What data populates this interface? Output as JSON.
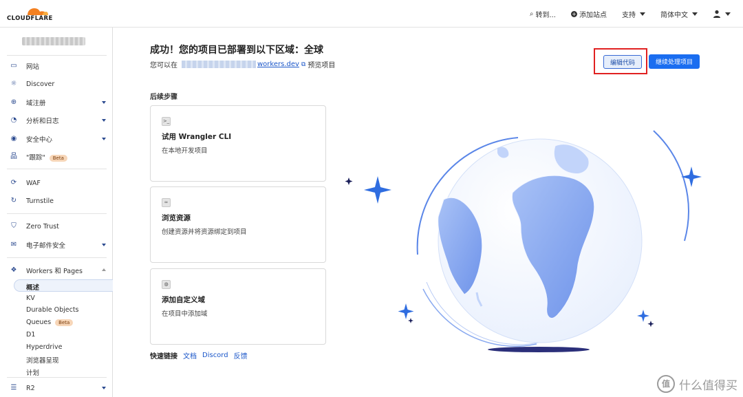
{
  "brand": {
    "name": "CLOUDFLARE",
    "accent": "#f38020"
  },
  "topnav": {
    "goto": "转到...",
    "add_site": "添加站点",
    "support": "支持",
    "language": "简体中文"
  },
  "sidebar": {
    "items": [
      {
        "label": "网站",
        "icon": "browser-icon"
      },
      {
        "label": "Discover",
        "icon": "lightbulb-icon"
      },
      {
        "label": "域注册",
        "icon": "globe-icon"
      },
      {
        "label": "分析和日志",
        "icon": "clock-chart-icon"
      },
      {
        "label": "安全中心",
        "icon": "target-icon"
      },
      {
        "label": "\"跟踪\"",
        "icon": "network-icon",
        "badge": "Beta"
      },
      {
        "label": "WAF",
        "icon": "waf-icon"
      },
      {
        "label": "Turnstile",
        "icon": "turnstile-icon"
      },
      {
        "label": "Zero Trust",
        "icon": "shield-icon"
      },
      {
        "label": "电子邮件安全",
        "icon": "mail-icon"
      },
      {
        "label": "Workers 和 Pages",
        "icon": "workers-icon"
      }
    ],
    "subitems": [
      {
        "label": "概述"
      },
      {
        "label": "KV"
      },
      {
        "label": "Durable Objects"
      },
      {
        "label": "Queues",
        "badge": "Beta"
      },
      {
        "label": "D1"
      },
      {
        "label": "Hyperdrive"
      },
      {
        "label": "浏览器呈现"
      },
      {
        "label": "计划"
      }
    ],
    "last": {
      "label": "R2",
      "icon": "database-icon"
    }
  },
  "main": {
    "title": "成功！您的项目已部署到以下区域：全球",
    "preview_prefix": "您可以在",
    "preview_link": "workers.dev",
    "preview_suffix": "预览项目",
    "edit_code": "编辑代码",
    "continue": "继续处理项目",
    "steps_heading": "后续步骤",
    "cards": [
      {
        "title": "试用 Wrangler CLI",
        "desc": "在本地开发项目",
        "icon": "terminal-icon"
      },
      {
        "title": "浏览资源",
        "desc": "创建资源并将资源绑定到项目",
        "icon": "link-icon"
      },
      {
        "title": "添加自定义域",
        "desc": "在项目中添加域",
        "icon": "globe-icon"
      }
    ],
    "quick_links": {
      "label": "快速链接",
      "links": [
        "文档",
        "Discord",
        "反馈"
      ]
    }
  },
  "watermark": {
    "text": "什么值得买",
    "glyph": "值"
  }
}
